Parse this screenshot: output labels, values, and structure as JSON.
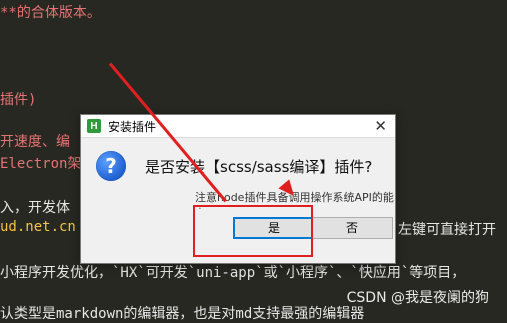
{
  "background_lines": [
    "**的合体版本。",
    "",
    "插件)",
    "开速度、编",
    "Electron架",
    "入，开发体",
    "ud.net.cn",
    "左键可直接打开",
    "小程序开发优化，`HX`可开发`uni-app`或`小程序`、`快应用`等项目，",
    "认类型是markdown的编辑器，也是对md支持最强的编辑器"
  ],
  "dialog": {
    "title": "安装插件",
    "app_icon": "H",
    "main_message": "是否安装【scss/sass编译】插件?",
    "sub_message": "注意node插件具备调用操作系统API的能力",
    "yes_label": "是",
    "no_label": "否",
    "close_symbol": "✕"
  },
  "watermark": "CSDN @我是夜阑的狗",
  "colors": {
    "background": "#272822",
    "annotation_red": "#e02020",
    "primary_border": "#0078d7"
  }
}
